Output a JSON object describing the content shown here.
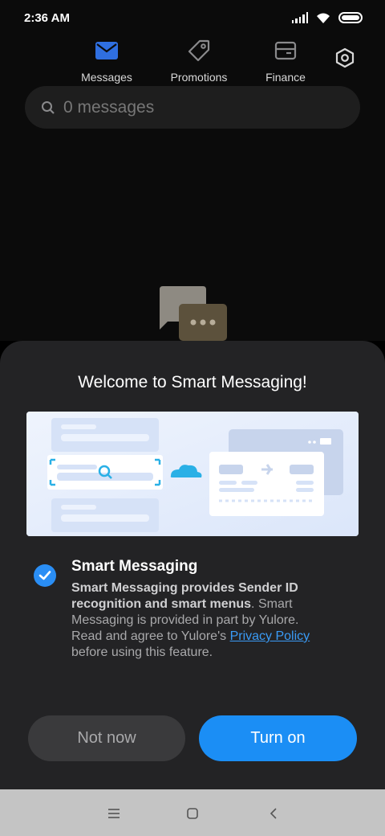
{
  "status_bar": {
    "time": "2:36 AM"
  },
  "tabs": [
    {
      "label": "Messages",
      "icon": "envelope-icon",
      "active": true
    },
    {
      "label": "Promotions",
      "icon": "tag-icon",
      "active": false
    },
    {
      "label": "Finance",
      "icon": "wallet-icon",
      "active": false
    }
  ],
  "search": {
    "placeholder": "0 messages"
  },
  "dialog": {
    "title": "Welcome to Smart Messaging!",
    "option_title": "Smart Messaging",
    "option_checked": true,
    "desc_bold": "Smart Messaging provides Sender ID recognition and smart menus",
    "desc_text_1": ". Smart Messaging is provided in part by Yulore. Read and agree to Yulore's ",
    "desc_link": "Privacy Policy",
    "desc_text_2": " before using this feature.",
    "secondary_button": "Not now",
    "primary_button": "Turn on"
  },
  "colors": {
    "accent": "#1b8ef5",
    "active_tab_icon": "#2f6fe0",
    "sheet_bg": "#232325",
    "app_bg": "#0b0b0b"
  }
}
